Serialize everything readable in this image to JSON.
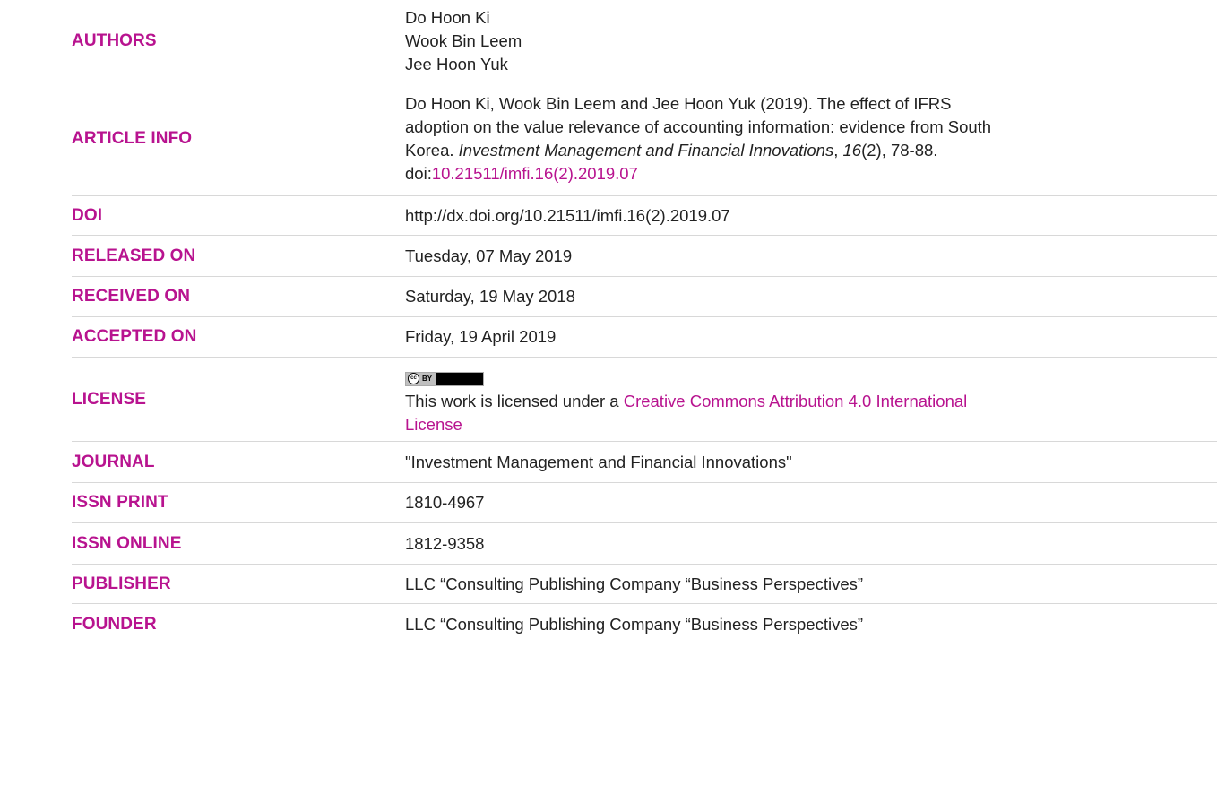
{
  "rows": [
    {
      "label": "AUTHORS",
      "lines": [
        "Do Hoon Ki",
        "Wook Bin Leem",
        "Jee Hoon Yuk"
      ]
    },
    {
      "label": "ARTICLE INFO",
      "citation": {
        "line1": "Do Hoon Ki, Wook Bin Leem and Jee Hoon Yuk (2019). The effect of IFRS",
        "line2": "adoption on the value relevance of accounting information: evidence from South",
        "line3_prefix": "Korea. ",
        "journal": "Investment Management and Financial Innovations",
        "comma": ", ",
        "volume": "16",
        "rest": "(2), 78-88.",
        "doi_prefix": "doi:",
        "doi_link": "10.21511/imfi.16(2).2019.07"
      }
    },
    {
      "label": "DOI",
      "value": "http://dx.doi.org/10.21511/imfi.16(2).2019.07"
    },
    {
      "label": "RELEASED ON",
      "value": "Tuesday, 07 May 2019"
    },
    {
      "label": "RECEIVED ON",
      "value": "Saturday, 19 May 2018"
    },
    {
      "label": "ACCEPTED ON",
      "value": "Friday, 19 April 2019"
    },
    {
      "label": "LICENSE",
      "badge": {
        "cc": "cc",
        "by": "BY"
      },
      "text": "This work is licensed under a ",
      "link_line1": "Creative Commons Attribution 4.0 International",
      "link_line2": "License"
    },
    {
      "label": "JOURNAL",
      "value": "\"Investment Management and Financial Innovations\""
    },
    {
      "label": "ISSN PRINT",
      "value": "1810-4967"
    },
    {
      "label": "ISSN ONLINE",
      "value": "1812-9358"
    },
    {
      "label": "PUBLISHER",
      "value": "LLC “Consulting Publishing Company “Business Perspectives”"
    },
    {
      "label": "FOUNDER",
      "value": "LLC “Consulting Publishing Company “Business Perspectives”"
    }
  ],
  "colors": {
    "label": "#b8138f",
    "link": "#b8138f",
    "text": "#222222",
    "divider": "#d8d8d8"
  }
}
